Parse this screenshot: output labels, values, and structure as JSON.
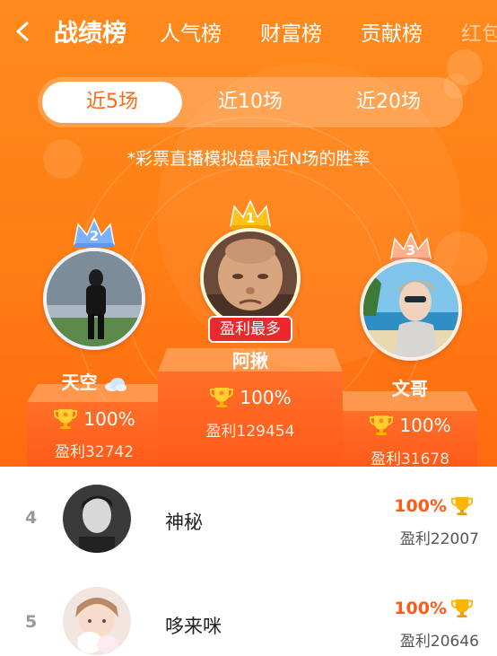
{
  "nav": {
    "tabs": [
      {
        "label": "战绩榜"
      },
      {
        "label": "人气榜"
      },
      {
        "label": "财富榜"
      },
      {
        "label": "贡献榜"
      },
      {
        "label": "红包"
      }
    ]
  },
  "period": {
    "options": [
      "近5场",
      "近10场",
      "近20场"
    ]
  },
  "note": "*彩票直播模拟盘最近N场的胜率",
  "podium": {
    "first": {
      "rank": "1",
      "name": "阿揪",
      "badge": "盈利最多",
      "rate": "100%",
      "profit": "盈利129454"
    },
    "second": {
      "rank": "2",
      "name": "天空",
      "rate": "100%",
      "profit": "盈利32742"
    },
    "third": {
      "rank": "3",
      "name": "文哥",
      "rate": "100%",
      "profit": "盈利31678"
    }
  },
  "list": [
    {
      "rank": "4",
      "name": "神秘",
      "rate": "100%",
      "profit": "盈利22007"
    },
    {
      "rank": "5",
      "name": "哆来咪",
      "rate": "100%",
      "profit": "盈利20646"
    }
  ],
  "colors": {
    "accent": "#ff7e14",
    "badge": "#ea2a2a",
    "gold": "#ffb400"
  }
}
